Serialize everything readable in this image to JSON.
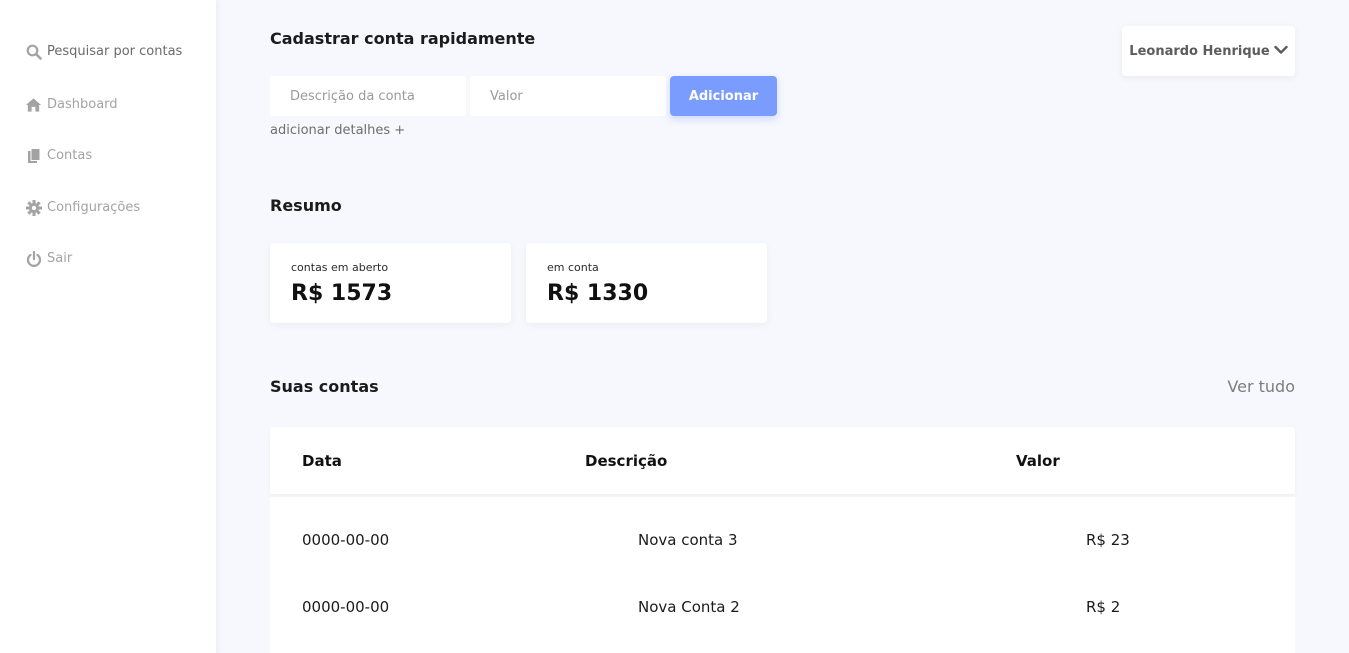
{
  "sidebar": {
    "items": [
      {
        "label": "Pesquisar por contas",
        "icon": "search-icon"
      },
      {
        "label": "Dashboard",
        "icon": "home-icon"
      },
      {
        "label": "Contas",
        "icon": "documents-icon"
      },
      {
        "label": "Configurações",
        "icon": "gear-icon"
      },
      {
        "label": "Sair",
        "icon": "power-icon"
      }
    ]
  },
  "quick_add": {
    "title": "Cadastrar conta rapidamente",
    "description_placeholder": "Descrição da conta",
    "value_placeholder": "Valor",
    "add_label": "Adicionar",
    "details_label": "adicionar detalhes +"
  },
  "user": {
    "name": "Leonardo Henrique"
  },
  "summary": {
    "title": "Resumo",
    "cards": [
      {
        "label": "contas em aberto",
        "amount": "R$ 1573"
      },
      {
        "label": "em conta",
        "amount": "R$ 1330"
      }
    ]
  },
  "accounts": {
    "title": "Suas contas",
    "see_all": "Ver tudo",
    "columns": [
      "Data",
      "Descrição",
      "Valor"
    ],
    "rows": [
      {
        "date": "0000-00-00",
        "description": "Nova conta 3",
        "value": "R$ 23"
      },
      {
        "date": "0000-00-00",
        "description": "Nova Conta 2",
        "value": "R$ 2"
      }
    ]
  },
  "colors": {
    "accent": "#7b9cff",
    "background": "#f7f8fd",
    "sidebar": "#ffffff"
  }
}
